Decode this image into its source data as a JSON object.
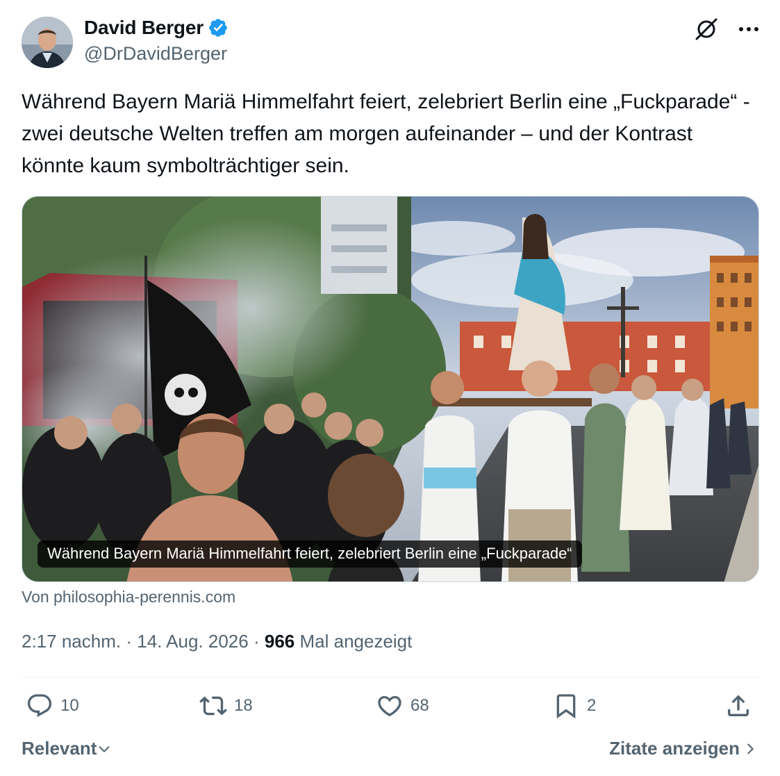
{
  "author": {
    "display_name": "David Berger",
    "handle": "@DrDavidBerger",
    "verified": true,
    "avatar_icon": "profile-photo",
    "verified_icon": "verified-badge-icon"
  },
  "header_actions": {
    "grok_icon": "grok-icon",
    "more_icon": "more-dots-icon"
  },
  "tweet": {
    "text": "Während Bayern Mariä Himmelfahrt feiert, zelebriert Berlin eine „Fuckparade“ - zwei deutsche Welten treffen am morgen aufeinander – und der Kontrast könnte kaum symbolträchtiger sein."
  },
  "media": {
    "caption": "Während Bayern Mariä Himmelfahrt feiert, zelebriert Berlin eine „Fuckparade“",
    "source": "Von philosophia-perennis.com"
  },
  "meta": {
    "time": "2:17 nachm.",
    "date": "14. Aug. 2026",
    "separator": "·",
    "views": "966",
    "views_label": "Mal angezeigt"
  },
  "actions": {
    "replies": "10",
    "reposts": "18",
    "likes": "68",
    "bookmarks": "2"
  },
  "footer": {
    "sort_label": "Relevant",
    "quotes_label": "Zitate anzeigen"
  },
  "colors": {
    "text_primary": "#0f1419",
    "text_secondary": "#536471",
    "verified_blue": "#1d9bf0",
    "divider": "#eff3f4"
  }
}
